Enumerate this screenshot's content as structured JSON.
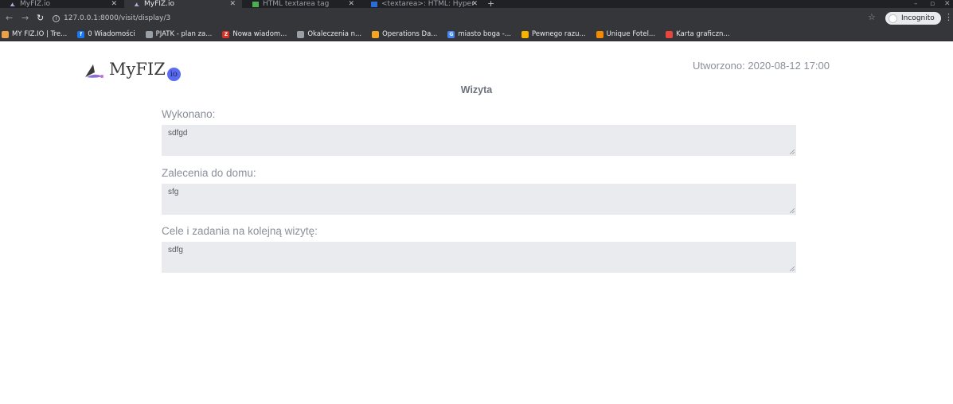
{
  "browser": {
    "tabs": [
      {
        "title": "MyFIZ.io",
        "active": false
      },
      {
        "title": "MyFIZ.io",
        "active": true
      },
      {
        "title": "HTML textarea tag",
        "active": false
      },
      {
        "title": "<textarea>: HTML: Hyper",
        "active": false
      }
    ],
    "new_tab": "+",
    "url": "127.0.0.1:8000/visit/display/3",
    "profile": "Incognito",
    "bookmarks": [
      {
        "label": "MY FIZ.IO | Tre...",
        "color": "#e8a04a"
      },
      {
        "label": "0 Wiadomości",
        "color": "#1877f2",
        "glyph": "f"
      },
      {
        "label": "PJATK - plan za...",
        "color": "#9aa0a6"
      },
      {
        "label": "Nowa wiadom...",
        "color": "#d93025",
        "glyph": "Z"
      },
      {
        "label": "Okaleczenia n...",
        "color": "#9aa0a6"
      },
      {
        "label": "Operations Da...",
        "color": "#f4a623"
      },
      {
        "label": "miasto boga -...",
        "color": "#4285f4",
        "glyph": "G"
      },
      {
        "label": "Pewnego razu...",
        "color": "#f4b400"
      },
      {
        "label": "Unique Fotel...",
        "color": "#f28b00"
      },
      {
        "label": "Karta graficzn...",
        "color": "#e8453c"
      }
    ]
  },
  "page": {
    "logo_text": "MyFIZ",
    "logo_suffix": "io",
    "created": "Utworzono: 2020-08-12 17:00",
    "title": "Wizyta",
    "fields": [
      {
        "label": "Wykonano:",
        "value": "sdfgd"
      },
      {
        "label": "Zalecenia do domu:",
        "value": "sfg"
      },
      {
        "label": "Cele i zadania na kolejną wizytę:",
        "value": "sdfg"
      }
    ]
  },
  "colors": {
    "accent": "#5b6bef",
    "field_bg": "#e9ebee",
    "label": "#8a8f99"
  }
}
